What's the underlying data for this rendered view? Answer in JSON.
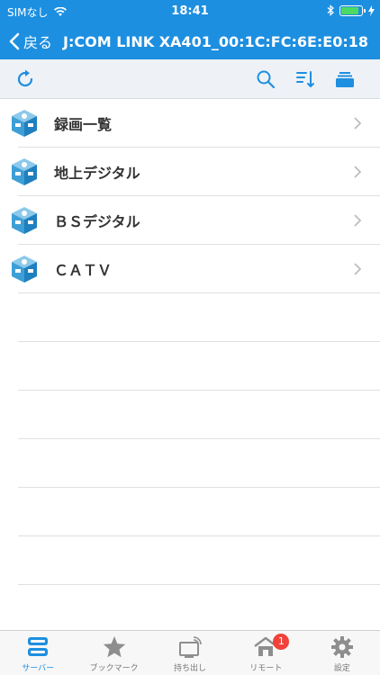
{
  "status": {
    "carrier": "SIMなし",
    "time": "18:41"
  },
  "navbar": {
    "back_label": "戻る",
    "title": "J:COM LINK XA401_00:1C:FC:6E:E0:18"
  },
  "list": {
    "items": [
      {
        "label": "録画一覧"
      },
      {
        "label": "地上デジタル"
      },
      {
        "label": "ＢＳデジタル"
      },
      {
        "label": "ＣＡＴＶ"
      }
    ]
  },
  "tabs": [
    {
      "label": "サーバー",
      "icon": "server-icon"
    },
    {
      "label": "ブックマーク",
      "icon": "star-icon"
    },
    {
      "label": "持ち出し",
      "icon": "cast-icon"
    },
    {
      "label": "リモート",
      "icon": "home-icon",
      "badge": "1"
    },
    {
      "label": "設定",
      "icon": "gear-icon"
    }
  ],
  "colors": {
    "accent": "#1d8fe0",
    "badge": "#f0423a"
  }
}
